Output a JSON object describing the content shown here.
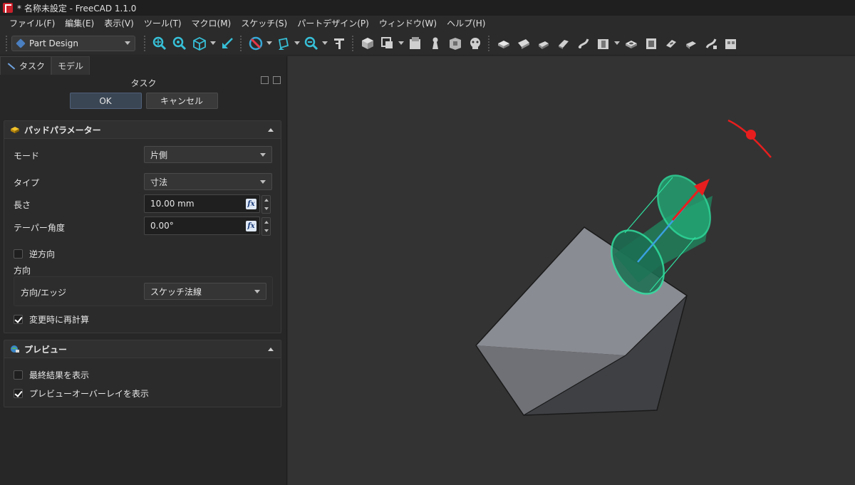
{
  "window": {
    "title": "* 名称未設定 - FreeCAD 1.1.0"
  },
  "menu": [
    "ファイル(F)",
    "編集(E)",
    "表示(V)",
    "ツール(T)",
    "マクロ(M)",
    "スケッチ(S)",
    "パートデザイン(P)",
    "ウィンドウ(W)",
    "ヘルプ(H)"
  ],
  "toolbar": {
    "workbench": "Part Design",
    "icons": [
      "zoom-fit-all-icon",
      "zoom-selection-icon",
      "view-cube-icon",
      "measure-icon",
      "draw-style-icon",
      "std-view-icon",
      "zoom-icon",
      "measure-tool-icon",
      "create-body-icon",
      "create-sketch-icon",
      "shape-binder-icon",
      "datum-point-icon",
      "sub-shape-binder-icon",
      "clone-icon",
      "pad-icon",
      "revolution-icon",
      "loft-icon",
      "pipe-icon",
      "helix-icon",
      "pocket-icon",
      "hole-icon",
      "groove-icon",
      "subtractive-loft-icon",
      "subtractive-pipe-icon",
      "subtractive-helix-icon"
    ]
  },
  "tabs": {
    "task": "タスク",
    "model": "モデル"
  },
  "task": {
    "header": "タスク",
    "ok": "OK",
    "cancel": "キャンセル"
  },
  "pad": {
    "title": "パッドパラメーター",
    "mode_label": "モード",
    "mode_value": "片側",
    "type_label": "タイプ",
    "type_value": "寸法",
    "length_label": "長さ",
    "length_value": "10.00 mm",
    "taper_label": "テーパー角度",
    "taper_value": "0.00°",
    "reversed_label": "逆方向",
    "reversed_checked": false,
    "direction_label": "方向",
    "direction_edge_label": "方向/エッジ",
    "direction_edge_value": "スケッチ法線",
    "recompute_label": "変更時に再計算",
    "recompute_checked": true
  },
  "preview": {
    "title": "プレビュー",
    "final_label": "最終結果を表示",
    "final_checked": false,
    "overlay_label": "プレビューオーバーレイを表示",
    "overlay_checked": true
  },
  "colors": {
    "accent": "#3b4654",
    "preview_green": "#2fe0a0",
    "direction_arrow": "#e81e1e",
    "sketch_normal": "#3aa0e0",
    "solid_face": "#8a8c93"
  }
}
